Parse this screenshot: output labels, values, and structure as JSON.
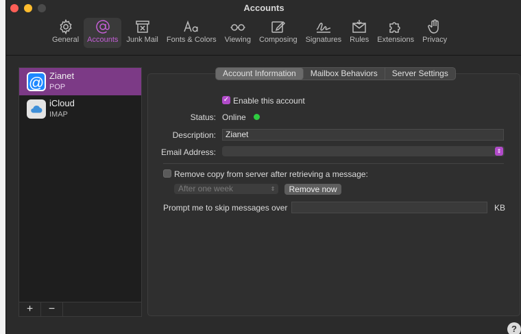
{
  "window": {
    "title": "Accounts"
  },
  "toolbar": {
    "items": [
      {
        "label": "General",
        "icon": "gear-icon"
      },
      {
        "label": "Accounts",
        "icon": "at-sign-icon",
        "active": true
      },
      {
        "label": "Junk Mail",
        "icon": "junk-trash-icon"
      },
      {
        "label": "Fonts & Colors",
        "icon": "fonts-icon"
      },
      {
        "label": "Viewing",
        "icon": "glasses-icon"
      },
      {
        "label": "Composing",
        "icon": "compose-icon"
      },
      {
        "label": "Signatures",
        "icon": "signature-icon"
      },
      {
        "label": "Rules",
        "icon": "rules-envelope-icon"
      },
      {
        "label": "Extensions",
        "icon": "puzzle-icon"
      },
      {
        "label": "Privacy",
        "icon": "hand-icon"
      }
    ],
    "active_color": "#c45fd6"
  },
  "accounts": [
    {
      "name": "Zianet",
      "type": "POP",
      "icon": "at-sign-account-icon",
      "selected": true
    },
    {
      "name": "iCloud",
      "type": "IMAP",
      "icon": "icloud-icon",
      "selected": false
    }
  ],
  "list_footer": {
    "add": "+",
    "remove": "−"
  },
  "tabs": [
    {
      "label": "Account Information",
      "active": true
    },
    {
      "label": "Mailbox Behaviors",
      "active": false
    },
    {
      "label": "Server Settings",
      "active": false
    }
  ],
  "form": {
    "enable_label": "Enable this account",
    "enable_checked": true,
    "status_label": "Status:",
    "status_value": "Online",
    "status_color": "#2ecc40",
    "description_label": "Description:",
    "description_value": "Zianet",
    "email_label": "Email Address:",
    "email_value": "",
    "remove_copy_label": "Remove copy from server after retrieving a message:",
    "remove_copy_checked": false,
    "remove_period_value": "After one week",
    "remove_now_label": "Remove now",
    "prompt_label": "Prompt me to skip messages over",
    "prompt_value": "",
    "prompt_unit": "KB"
  },
  "help": {
    "label": "?"
  },
  "colors": {
    "accent": "#b14bc9",
    "selection": "#7c3a86"
  }
}
